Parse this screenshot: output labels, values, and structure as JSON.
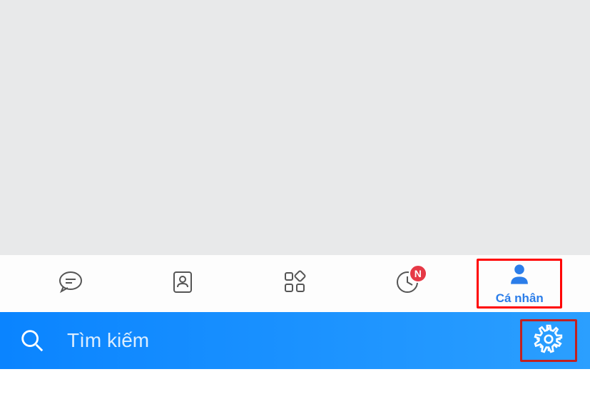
{
  "nav": {
    "profile_label": "Cá nhân",
    "badge_text": "N"
  },
  "search": {
    "placeholder": "Tìm kiếm"
  },
  "colors": {
    "accent": "#2b7de9",
    "badge": "#e63946",
    "highlight": "#ff0000"
  }
}
